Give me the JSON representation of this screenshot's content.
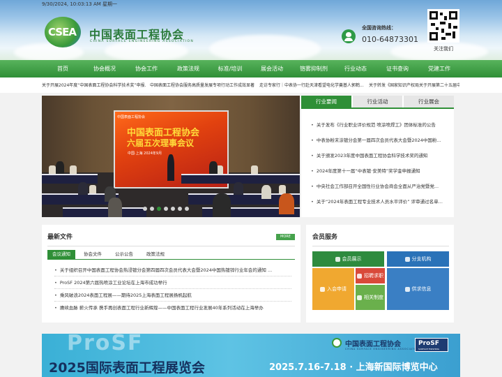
{
  "header": {
    "datetime": "9/30/2024, 10:03:13 AM 星期一",
    "logo_text": "CSEA",
    "org_name": "中国表面工程协会",
    "org_name_en": "CHINA SURFACE ENGINEERING ASSOCIATION",
    "hotline_label": "全国咨询热线：",
    "hotline_number": "010-64873301",
    "qr_label": "关注我们"
  },
  "nav": [
    "首页",
    "协会概况",
    "协会工作",
    "政策法规",
    "标准/培训",
    "展会活动",
    "铬雾抑制剂",
    "行业动态",
    "证书查询",
    "党建工作"
  ],
  "ticker": [
    "关于开展2024年度“中国表面工程协会科学技术奖”申报...",
    "中国表面工程协会服务高质量发展专项行动工作成效显著",
    "走访专家行｜中表协一行赴天津看望电化学奠基人郭鹤...",
    "关于转发《国家知识产权局关于开展第二十五届中..."
  ],
  "slider": {
    "screen_head": "中国表面工程协会",
    "screen_title1": "中国表面工程协会",
    "screen_title2": "六届五次理事会议",
    "screen_date": "中国·上海 2024年9月"
  },
  "newsbox": {
    "tabs": [
      "行业要闻",
      "行业活动",
      "行业展会"
    ],
    "items": [
      "关于发布《行业职业评价规范 喷涂喷焊工》团体标准的公告",
      "中表协粉末涂镀分会第一届四次会员代表大会暨2024中国粉...",
      "关于颁发2023年度中国表面工程协会科学技术奖的通知",
      "2024年度第十一届“中表镀·安美特”奖学金申报通知",
      "中央社会工作部召开全国性行业协会商会全面从严治党暨党...",
      "关于“2024年表面工程专业技术人员水平评价” 评审通过名单..."
    ]
  },
  "docs": {
    "title": "最新文件",
    "more": "MORE",
    "tabs": [
      "会议通知",
      "协会文件",
      "公示公告",
      "政策法规"
    ],
    "items": [
      "关于组织召开中国表面工程协会热浸镀分会第四届四次会员代表大会暨2024中国热镀锌行业年会的通知 ...",
      "ProSF 2024第六届热喷涂工业论坛在上海市成功举行",
      "乘风破浪2024表面工程展——期待2025上海表面工程展扬帆起航",
      "赓续血脉 薪火传承 携手再创表面工程行业新辉煌——中国表面工程行业发展40年系列活动在上海举办"
    ]
  },
  "member": {
    "title": "会员服务",
    "buttons": [
      "会员展示",
      "分支机构",
      "招聘求职",
      "入会申请",
      "相关制度",
      "供求信息"
    ],
    "colors": [
      "#2e8b3e",
      "#2a72b8",
      "#d94a3a",
      "#f0a830",
      "#6ab04c",
      "#3a7fc4"
    ]
  },
  "banner": {
    "prosf_watermark": "ProSF",
    "title": "2025国际表面工程展览会",
    "date": "2025.7.16-7.18 · 上海新国际博览中心",
    "org": "中国表面工程协会",
    "org_en": "CHINA SURFACE ENGINEERING ASSOCIATION",
    "badge": "ProSF",
    "badge_sub": "SURFACE FINISHING"
  }
}
